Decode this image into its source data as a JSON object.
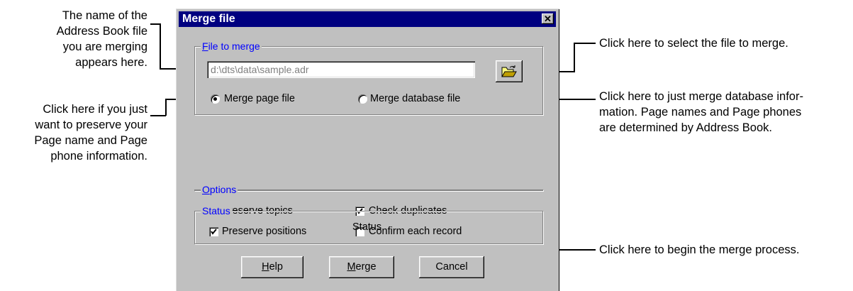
{
  "dialog": {
    "title": "Merge file",
    "close_glyph": "✕"
  },
  "file_group": {
    "legend_hotkey": "F",
    "legend_rest": "ile to merge",
    "path_value": "d:\\dts\\data\\sample.adr",
    "browse_icon": "folder-open-icon",
    "radio_page_label": "Merge page file",
    "radio_database_label": "Merge database file",
    "radio_selected": "page"
  },
  "options_group": {
    "legend_hotkey": "O",
    "legend_rest": "ptions",
    "checkboxes": [
      {
        "label": "Preserve topics",
        "checked": true
      },
      {
        "label": "Check duplicates",
        "checked": true
      },
      {
        "label": "Preserve positions",
        "checked": true
      },
      {
        "label": "Confirm each record",
        "checked": false
      }
    ]
  },
  "status_group": {
    "legend": "Status",
    "text": "Status"
  },
  "buttons": {
    "help_hotkey": "H",
    "help_rest": "elp",
    "merge_hotkey": "M",
    "merge_rest": "erge",
    "cancel": "Cancel"
  },
  "annotations": {
    "filename_note": [
      "The name of the",
      "Address Book file",
      "you are merging",
      "appears here."
    ],
    "page_note": [
      "Click here if you just",
      "want to preserve your",
      "Page name and Page",
      "phone information."
    ],
    "select_note": "Click here to select the file to merge.",
    "database_note": [
      "Click here to just merge database infor-",
      "mation. Page names and Page phones",
      "are determined by Address Book."
    ],
    "begin_note": "Click here to begin the merge process."
  },
  "colors": {
    "title_bar": "#000080",
    "dialog_face": "#c0c0c0",
    "group_legend": "#0000ff"
  }
}
